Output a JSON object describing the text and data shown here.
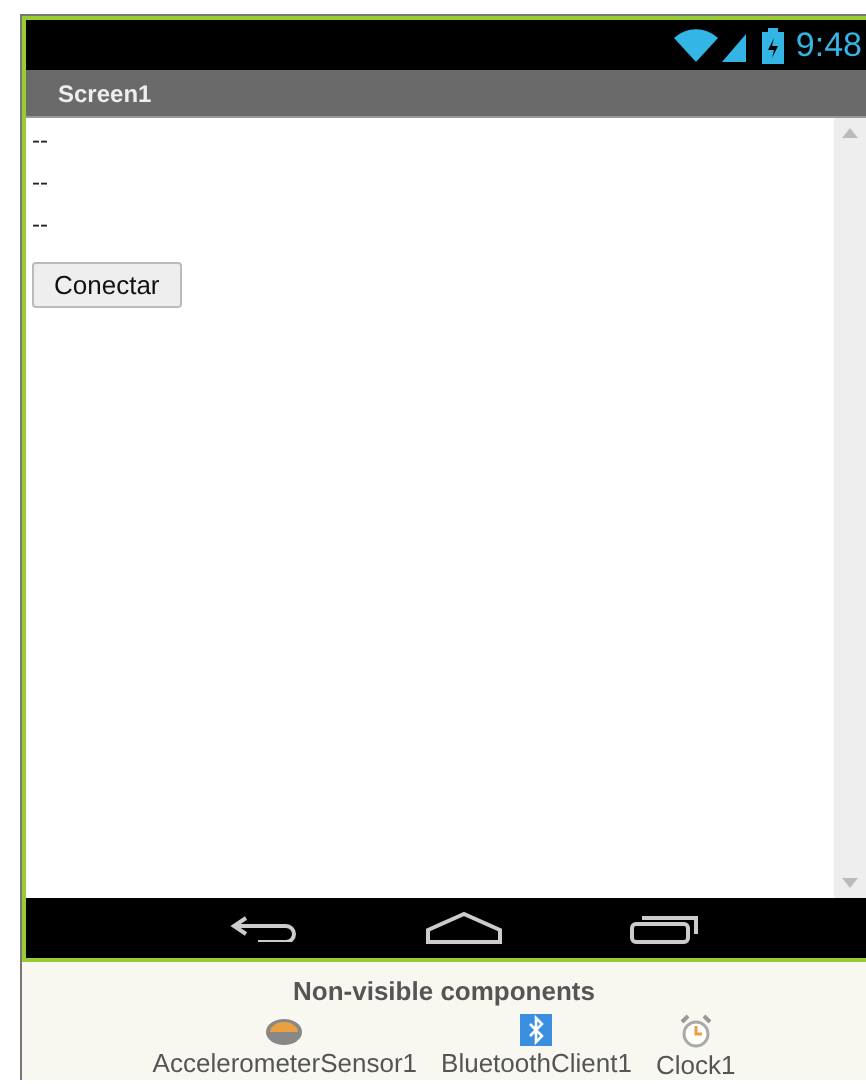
{
  "status_bar": {
    "time": "9:48"
  },
  "title_bar": {
    "title": "Screen1"
  },
  "labels": [
    "--",
    "--",
    "--"
  ],
  "button": {
    "label": "Conectar"
  },
  "non_visible": {
    "heading": "Non-visible components",
    "components": [
      {
        "kind": "accelerometer",
        "name": "AccelerometerSensor1"
      },
      {
        "kind": "bluetooth",
        "name": "BluetoothClient1"
      },
      {
        "kind": "clock",
        "name": "Clock1"
      }
    ]
  }
}
